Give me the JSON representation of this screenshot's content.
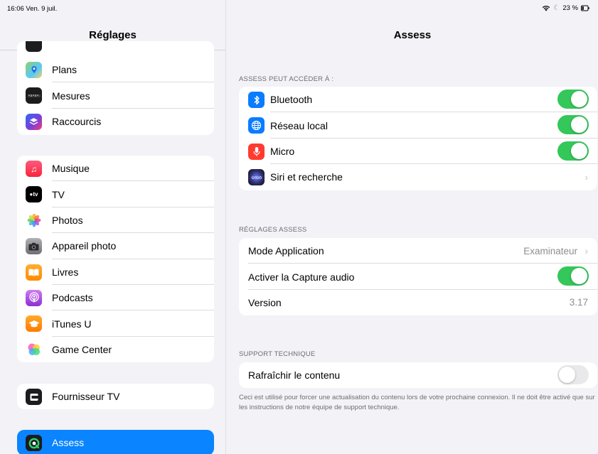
{
  "status_bar": {
    "time": "16:06",
    "date": "Ven. 9 juil.",
    "battery": "23 %"
  },
  "sidebar": {
    "title": "Réglages",
    "group1": [
      {
        "label": "Plans",
        "icon": "maps-icon",
        "color": "#5ac8fa"
      },
      {
        "label": "Mesures",
        "icon": "measure-icon",
        "color": "#1c1c1e"
      },
      {
        "label": "Raccourcis",
        "icon": "shortcuts-icon",
        "color": "#5b3fd6"
      }
    ],
    "group2": [
      {
        "label": "Musique",
        "icon": "music-icon",
        "color": "#fc3c44"
      },
      {
        "label": "TV",
        "icon": "tv-icon",
        "color": "#000000"
      },
      {
        "label": "Photos",
        "icon": "photos-icon",
        "color": "#ffffff"
      },
      {
        "label": "Appareil photo",
        "icon": "camera-icon",
        "color": "#8e8e93"
      },
      {
        "label": "Livres",
        "icon": "books-icon",
        "color": "#ff9500"
      },
      {
        "label": "Podcasts",
        "icon": "podcasts-icon",
        "color": "#b150e2"
      },
      {
        "label": "iTunes U",
        "icon": "itunes-u-icon",
        "color": "#ff9500"
      },
      {
        "label": "Game Center",
        "icon": "game-center-icon",
        "color": "#ffffff"
      }
    ],
    "group3": [
      {
        "label": "Fournisseur TV",
        "icon": "tv-provider-icon",
        "color": "#1c1c1e"
      }
    ],
    "active": {
      "label": "Assess",
      "icon": "assess-icon",
      "color": "#0a84ff"
    }
  },
  "main": {
    "title": "Assess",
    "access": {
      "header": "ASSESS PEUT ACCÉDER À :",
      "bluetooth": "Bluetooth",
      "local_network": "Réseau local",
      "micro": "Micro",
      "siri": "Siri et recherche"
    },
    "settings": {
      "header": "RÉGLAGES ASSESS",
      "mode_label": "Mode Application",
      "mode_value": "Examinateur",
      "capture_label": "Activer la Capture audio",
      "version_label": "Version",
      "version_value": "3.17"
    },
    "support": {
      "header": "SUPPORT TECHNIQUE",
      "refresh_label": "Rafraîchir le contenu",
      "note": "Ceci est utilisé pour forcer une actualisation du contenu lors de votre prochaine connexion. Il ne doit être activé que sur les instructions de notre équipe de support technique."
    },
    "toggles": {
      "bluetooth": true,
      "local_network": true,
      "micro": true,
      "capture_audio": true,
      "refresh": false
    },
    "accent_green": "#34c759"
  }
}
